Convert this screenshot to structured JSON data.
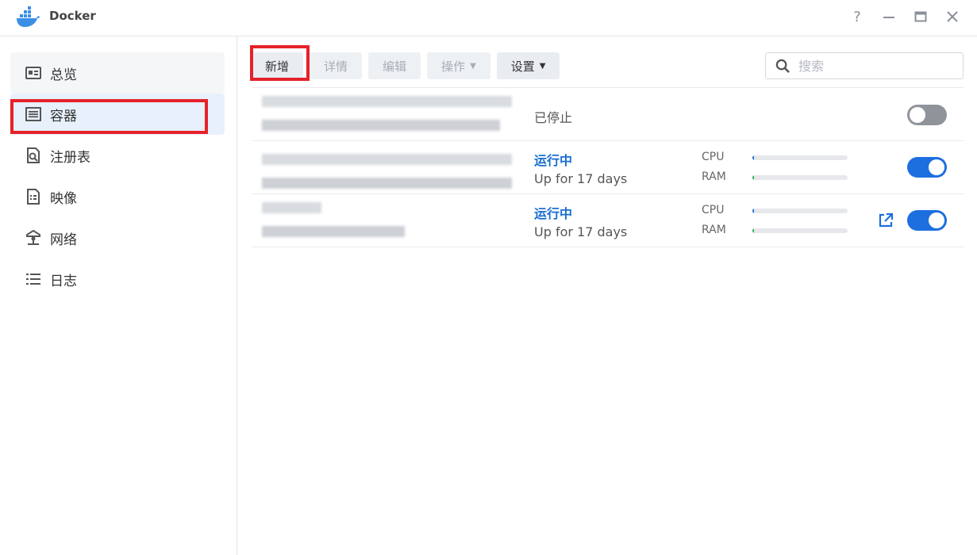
{
  "window": {
    "title": "Docker",
    "controls": [
      "help-icon",
      "minimize-icon",
      "maximize-icon",
      "close-icon"
    ],
    "help_glyph": "?"
  },
  "sidebar": {
    "items": [
      {
        "label": "总览",
        "icon": "overview-icon"
      },
      {
        "label": "容器",
        "icon": "container-icon",
        "active": true
      },
      {
        "label": "注册表",
        "icon": "registry-icon"
      },
      {
        "label": "映像",
        "icon": "image-icon"
      },
      {
        "label": "网络",
        "icon": "network-icon"
      },
      {
        "label": "日志",
        "icon": "log-icon"
      }
    ]
  },
  "toolbar": {
    "add_label": "新增",
    "details_label": "详情",
    "edit_label": "编辑",
    "action_label": "操作",
    "settings_label": "设置"
  },
  "search": {
    "placeholder": "搜索"
  },
  "containers": [
    {
      "status": "已停止",
      "uptime": "",
      "running": false
    },
    {
      "status": "运行中",
      "uptime": "Up for 17 days",
      "running": true,
      "cpu": 0.01,
      "ram": 0.01
    },
    {
      "status": "运行中",
      "uptime": "Up for 17 days",
      "running": true,
      "cpu": 0.0,
      "ram": 0.01,
      "has_link": true
    }
  ],
  "meters": {
    "cpu_label": "CPU",
    "ram_label": "RAM"
  },
  "colors": {
    "accent": "#1d6fe0",
    "status_running": "#1a6fd1",
    "highlight_box": "#e5222a",
    "cpu_fill": "#1d6fe0",
    "ram_fill": "#2bb24c"
  }
}
